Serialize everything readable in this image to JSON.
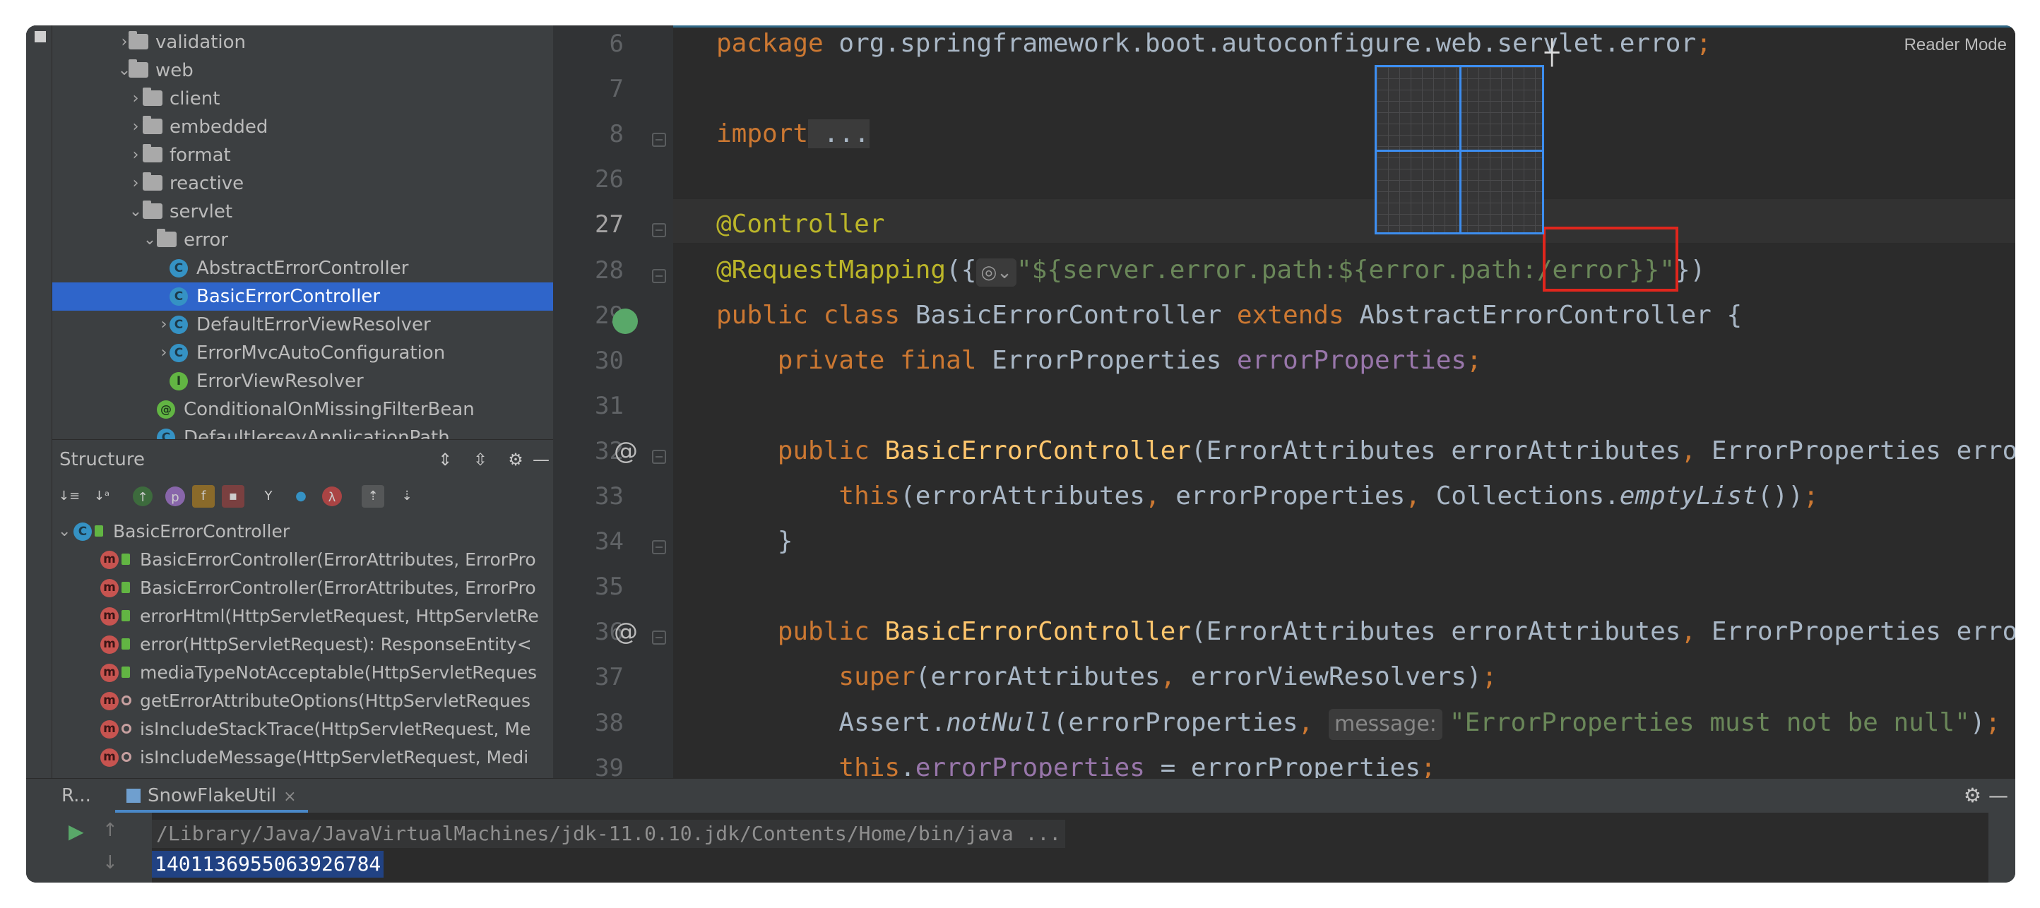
{
  "project_tree": {
    "items": [
      {
        "label": "validation",
        "kind": "folder",
        "expanded": false
      },
      {
        "label": "web",
        "kind": "folder",
        "expanded": true
      },
      {
        "label": "client",
        "kind": "folder",
        "expanded": false
      },
      {
        "label": "embedded",
        "kind": "folder",
        "expanded": false
      },
      {
        "label": "format",
        "kind": "folder",
        "expanded": false
      },
      {
        "label": "reactive",
        "kind": "folder",
        "expanded": false
      },
      {
        "label": "servlet",
        "kind": "folder",
        "expanded": true
      },
      {
        "label": "error",
        "kind": "folder",
        "expanded": true
      },
      {
        "label": "AbstractErrorController",
        "kind": "class"
      },
      {
        "label": "BasicErrorController",
        "kind": "class",
        "selected": true
      },
      {
        "label": "DefaultErrorViewResolver",
        "kind": "class"
      },
      {
        "label": "ErrorMvcAutoConfiguration",
        "kind": "class"
      },
      {
        "label": "ErrorViewResolver",
        "kind": "interface"
      },
      {
        "label": "ConditionalOnMissingFilterBean",
        "kind": "annotation"
      },
      {
        "label": "DefaultJerseyApplicationPath",
        "kind": "class"
      }
    ]
  },
  "structure": {
    "title": "Structure",
    "root": "BasicErrorController",
    "members": [
      {
        "label": "BasicErrorController(ErrorAttributes, ErrorPro",
        "vis": "public"
      },
      {
        "label": "BasicErrorController(ErrorAttributes, ErrorPro",
        "vis": "public"
      },
      {
        "label": "errorHtml(HttpServletRequest, HttpServletRe",
        "vis": "public"
      },
      {
        "label": "error(HttpServletRequest): ResponseEntity<",
        "vis": "public"
      },
      {
        "label": "mediaTypeNotAcceptable(HttpServletReques",
        "vis": "public"
      },
      {
        "label": "getErrorAttributeOptions(HttpServletReques",
        "vis": "private"
      },
      {
        "label": "isIncludeStackTrace(HttpServletRequest, Me",
        "vis": "private"
      },
      {
        "label": "isIncludeMessage(HttpServletRequest, Medi",
        "vis": "private"
      }
    ]
  },
  "editor": {
    "reader_mode": "Reader Mode",
    "line_numbers": [
      "6",
      "7",
      "8",
      "26",
      "27",
      "28",
      "29",
      "30",
      "31",
      "32",
      "33",
      "34",
      "35",
      "36",
      "37",
      "38",
      "39"
    ],
    "current_line": "27",
    "code": {
      "l6_kw": "package",
      "l6_pkg": " org.springframework.boot.autoconfigure.web.servlet.error",
      "l6_semi": ";",
      "l8_kw": "import",
      "l8_fold": " ...",
      "l27_ann": "@Controller",
      "l28_ann": "@RequestMapping",
      "l28_open": "({",
      "l28_chip": "◎⌄",
      "l28_str": "\"${server.error.path:${error.path:/error}}\"",
      "l28_close": "})",
      "l29_kw": "public class",
      "l29_name": " BasicErrorController ",
      "l29_ext": "extends",
      "l29_rest": " AbstractErrorController {",
      "l30_kw": "private final",
      "l30_type": " ErrorProperties ",
      "l30_field": "errorProperties",
      "l30_semi": ";",
      "l32_kw": "public",
      "l32_name": "BasicErrorController",
      "l32_p1": "(ErrorAttributes errorAttributes",
      "l32_comma": ",",
      "l32_p2": " ErrorProperties errorPr",
      "l33_kw": "this",
      "l33_args": "(errorAttributes",
      "l33_c1": ",",
      "l33_a2": " errorProperties",
      "l33_c2": ",",
      "l33_a3": " Collections.",
      "l33_call": "emptyList",
      "l33_end": "())",
      "l33_semi": ";",
      "l34": "}",
      "l36_kw": "public",
      "l36_name": "BasicErrorController",
      "l36_p1": "(ErrorAttributes errorAttributes",
      "l36_comma": ",",
      "l36_p2": " ErrorProperties errorPr",
      "l37_kw": "super",
      "l37_args": "(errorAttributes",
      "l37_c1": ",",
      "l37_a2": " errorViewResolvers)",
      "l37_semi": ";",
      "l38_cls": "Assert.",
      "l38_call": "notNull",
      "l38_args": "(errorProperties",
      "l38_c1": ",",
      "l38_hint": "message:",
      "l38_str": "\"ErrorProperties must not be null\"",
      "l38_end": ")",
      "l38_semi": ";",
      "l39_kw": "this",
      "l39_dot": ".",
      "l39_field": "errorProperties",
      "l39_rest": " = errorProperties",
      "l39_semi": ";"
    }
  },
  "run": {
    "label": "R...",
    "tab": "SnowFlakeUtil",
    "tab_close": "×",
    "command": "/Library/Java/JavaVirtualMachines/jdk-11.0.10.jdk/Contents/Home/bin/java ...",
    "output": "1401136955063926784"
  },
  "icons": {
    "chevron_right": "›",
    "chevron_down": "⌄",
    "gear": "⚙",
    "minimize": "—",
    "play": "▶",
    "arrow_up": "↑",
    "arrow_down": "↓",
    "at_sign": "@"
  },
  "colors": {
    "keyword": "#cc7832",
    "annotation": "#bbb529",
    "string": "#6a8759",
    "field": "#9876aa",
    "method_decl": "#ffc66d",
    "selection": "#2f65ca",
    "highlight_box": "#e0261d"
  }
}
